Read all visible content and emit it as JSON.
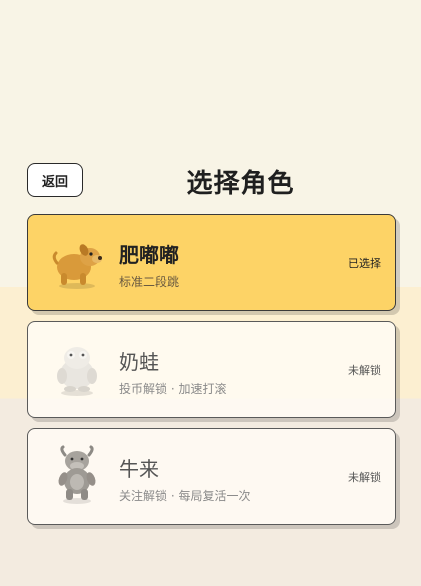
{
  "header": {
    "back_label": "返回",
    "title": "选择角色"
  },
  "characters": [
    {
      "name": "肥嘟嘟",
      "desc": "标准二段跳",
      "status": "已选择",
      "icon": "yellow-dog-icon"
    },
    {
      "name": "奶蛙",
      "desc": "投币解锁 · 加速打滚",
      "status": "未解锁",
      "icon": "white-frog-icon"
    },
    {
      "name": "牛来",
      "desc": "关注解锁 · 每局复活一次",
      "status": "未解锁",
      "icon": "cow-icon"
    }
  ],
  "colors": {
    "selected_card": "#fdd366",
    "locked_card": "#fffbf5"
  }
}
